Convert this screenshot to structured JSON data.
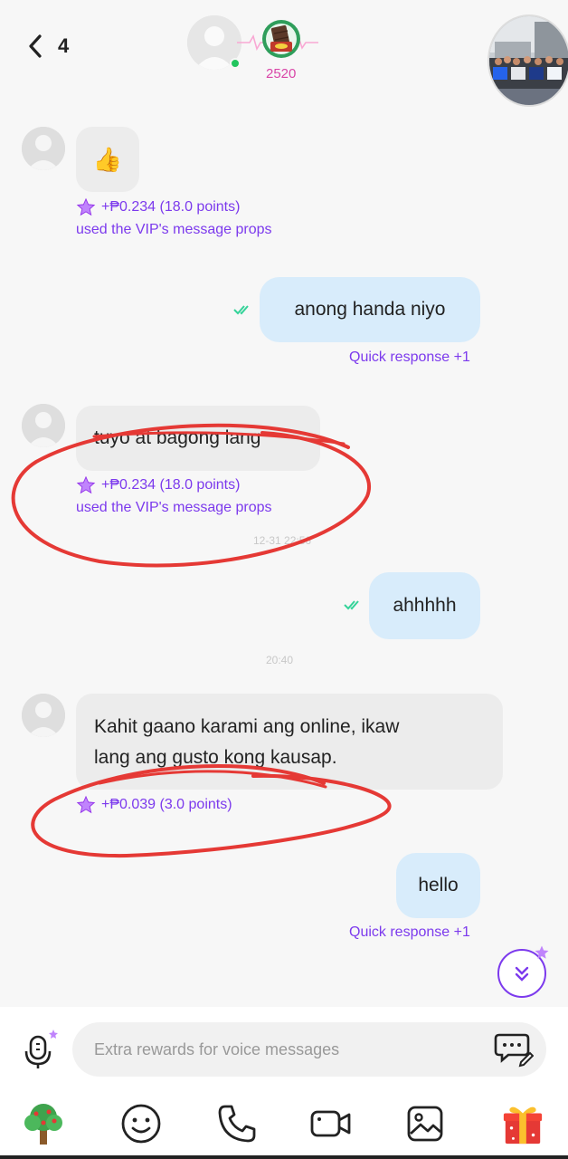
{
  "header": {
    "unread_count": "4",
    "points": "2520"
  },
  "messages": [
    {
      "direction": "incoming",
      "type": "emoji",
      "content": "👍",
      "reward": "+₱0.234 (18.0 points)",
      "props": "used the VIP's message props"
    },
    {
      "direction": "outgoing",
      "content": "anong handa niyo",
      "status": "read",
      "footer": "Quick response +1"
    },
    {
      "direction": "incoming",
      "content": "tuyo at bagong lang",
      "reward": "+₱0.234 (18.0 points)",
      "props": "used the VIP's message props"
    },
    {
      "type": "timestamp",
      "content": "12-31 22:56"
    },
    {
      "direction": "outgoing",
      "content": "ahhhhh",
      "status": "read"
    },
    {
      "type": "timestamp",
      "content": "20:40"
    },
    {
      "direction": "incoming",
      "content": [
        "Kahit gaano karami ang online, ikaw",
        "lang ang gusto kong kausap."
      ],
      "reward": "+₱0.039 (3.0 points)"
    },
    {
      "direction": "outgoing",
      "content": "hello",
      "footer": "Quick response +1"
    }
  ],
  "input": {
    "placeholder": "Extra rewards for voice messages"
  },
  "toolbar": [
    "tree-icon",
    "emoji-icon",
    "phone-icon",
    "video-call-icon",
    "image-icon",
    "gift-icon"
  ],
  "colors": {
    "accent": "#7c3aed",
    "outgoing_bubble": "#d8ecfb",
    "incoming_bubble": "#ececec",
    "online": "#22c55e",
    "points": "#d946a8",
    "annotation": "#e53935"
  }
}
